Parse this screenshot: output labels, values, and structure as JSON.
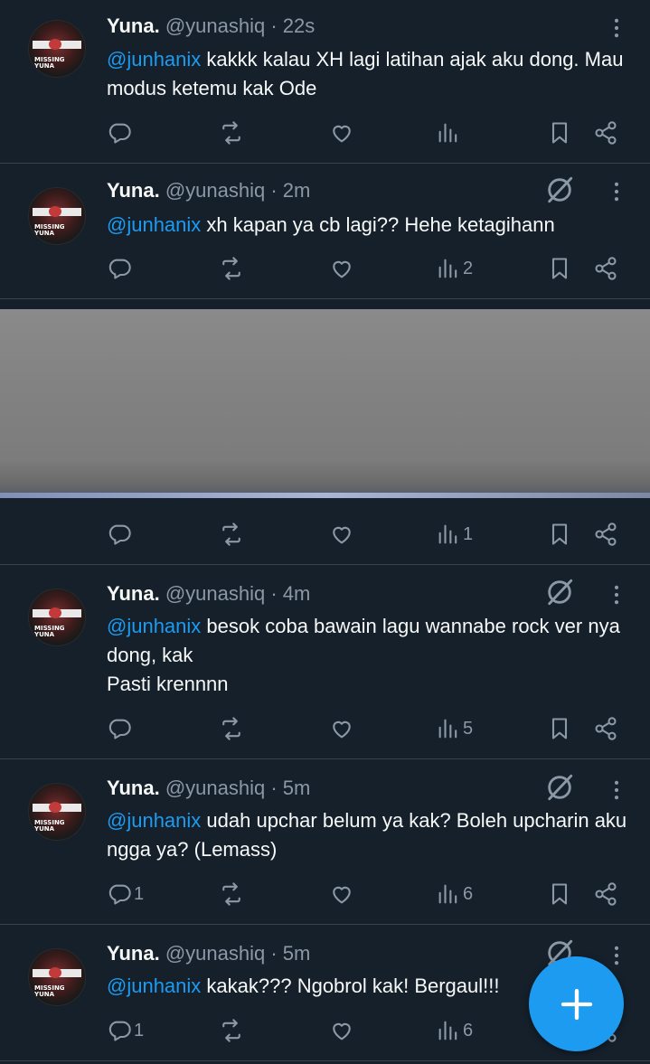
{
  "colors": {
    "background": "#15202b",
    "mention": "#1d9bf0",
    "muted": "#8b98a5",
    "fab": "#1d9bf0"
  },
  "tweets": [
    {
      "name": "Yuna.",
      "handle": "@yunashiq",
      "time": "· 22s",
      "mention": "@junhanix",
      "text": " kakkk kalau XH lagi latihan ajak aku dong. Mau modus ketemu kak Ode",
      "reply_count": "",
      "views": "",
      "show_grok": false
    },
    {
      "name": "Yuna.",
      "handle": "@yunashiq",
      "time": "· 2m",
      "mention": "@junhanix",
      "text": " xh kapan ya cb lagi?? Hehe ketagihann",
      "reply_count": "",
      "views": "2",
      "show_grok": true
    },
    {
      "reply_count": "",
      "views": "1",
      "covered": true
    },
    {
      "name": "Yuna.",
      "handle": "@yunashiq",
      "time": "· 4m",
      "mention": "@junhanix",
      "text": " besok coba bawain lagu wannabe rock ver nya dong, kak\nPasti krennnn",
      "reply_count": "",
      "views": "5",
      "show_grok": true
    },
    {
      "name": "Yuna.",
      "handle": "@yunashiq",
      "time": "· 5m",
      "mention": "@junhanix",
      "text": " udah upchar belum ya kak? Boleh upcharin aku ngga ya? (Lemass)",
      "reply_count": "1",
      "views": "6",
      "show_grok": true
    },
    {
      "name": "Yuna.",
      "handle": "@yunashiq",
      "time": "· 5m",
      "mention": "@junhanix",
      "text": " kakak??? Ngobrol kak! Bergaul!!!",
      "reply_count": "1",
      "views": "6",
      "show_grok": true
    }
  ],
  "icons": {
    "reply": "reply-icon",
    "retweet": "retweet-icon",
    "like": "heart-icon",
    "views": "views-icon",
    "bookmark": "bookmark-icon",
    "share": "share-icon",
    "grok": "grok-icon",
    "more": "more-icon",
    "compose": "plus-icon"
  }
}
